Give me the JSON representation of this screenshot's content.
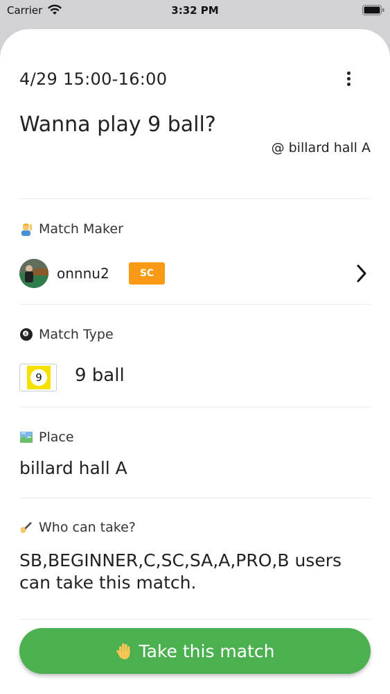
{
  "status_bar": {
    "carrier": "Carrier",
    "time": "3:32 PM"
  },
  "match": {
    "datetime": "4/29 15:00-16:00",
    "title": "Wanna play 9 ball?",
    "venue": "@ billard hall A"
  },
  "maker": {
    "label": "Match Maker",
    "name": "onnnu2",
    "badge": "SC",
    "badge_color": "#fa9a14"
  },
  "type": {
    "label": "Match Type",
    "ball_number": "9",
    "value": "9 ball"
  },
  "place": {
    "label": "Place",
    "value": "billard hall A"
  },
  "who": {
    "label": "Who can take?",
    "value": "SB,BEGINNER,C,SC,SA,A,PRO,B users can take this match."
  },
  "action": {
    "label": "Take this match",
    "color": "#4caf50"
  },
  "icons": [
    "wifi-icon",
    "battery-icon",
    "more-vert-icon",
    "person-raising-hand-icon",
    "8-ball-icon",
    "chevron-right-icon",
    "9-ball-icon",
    "map-icon",
    "writing-hand-icon",
    "raised-hand-icon"
  ]
}
